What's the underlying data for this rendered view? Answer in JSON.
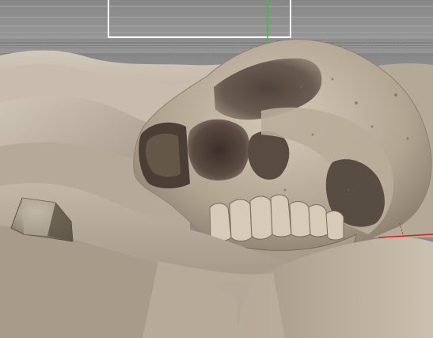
{
  "viewport": {
    "background_color": "#8a8a8a",
    "grid_color": "#9c9c9c",
    "terrain_color": "#b9ad9e",
    "skull_color": "#c4b8a6",
    "frame_color": "#ffffff",
    "axis_y_color": "#3bbf3b",
    "axis_x_color": "#d02020",
    "icons": [
      "render-frame-icon",
      "y-axis-icon",
      "x-axis-icon",
      "skull-model",
      "rock-model"
    ]
  }
}
